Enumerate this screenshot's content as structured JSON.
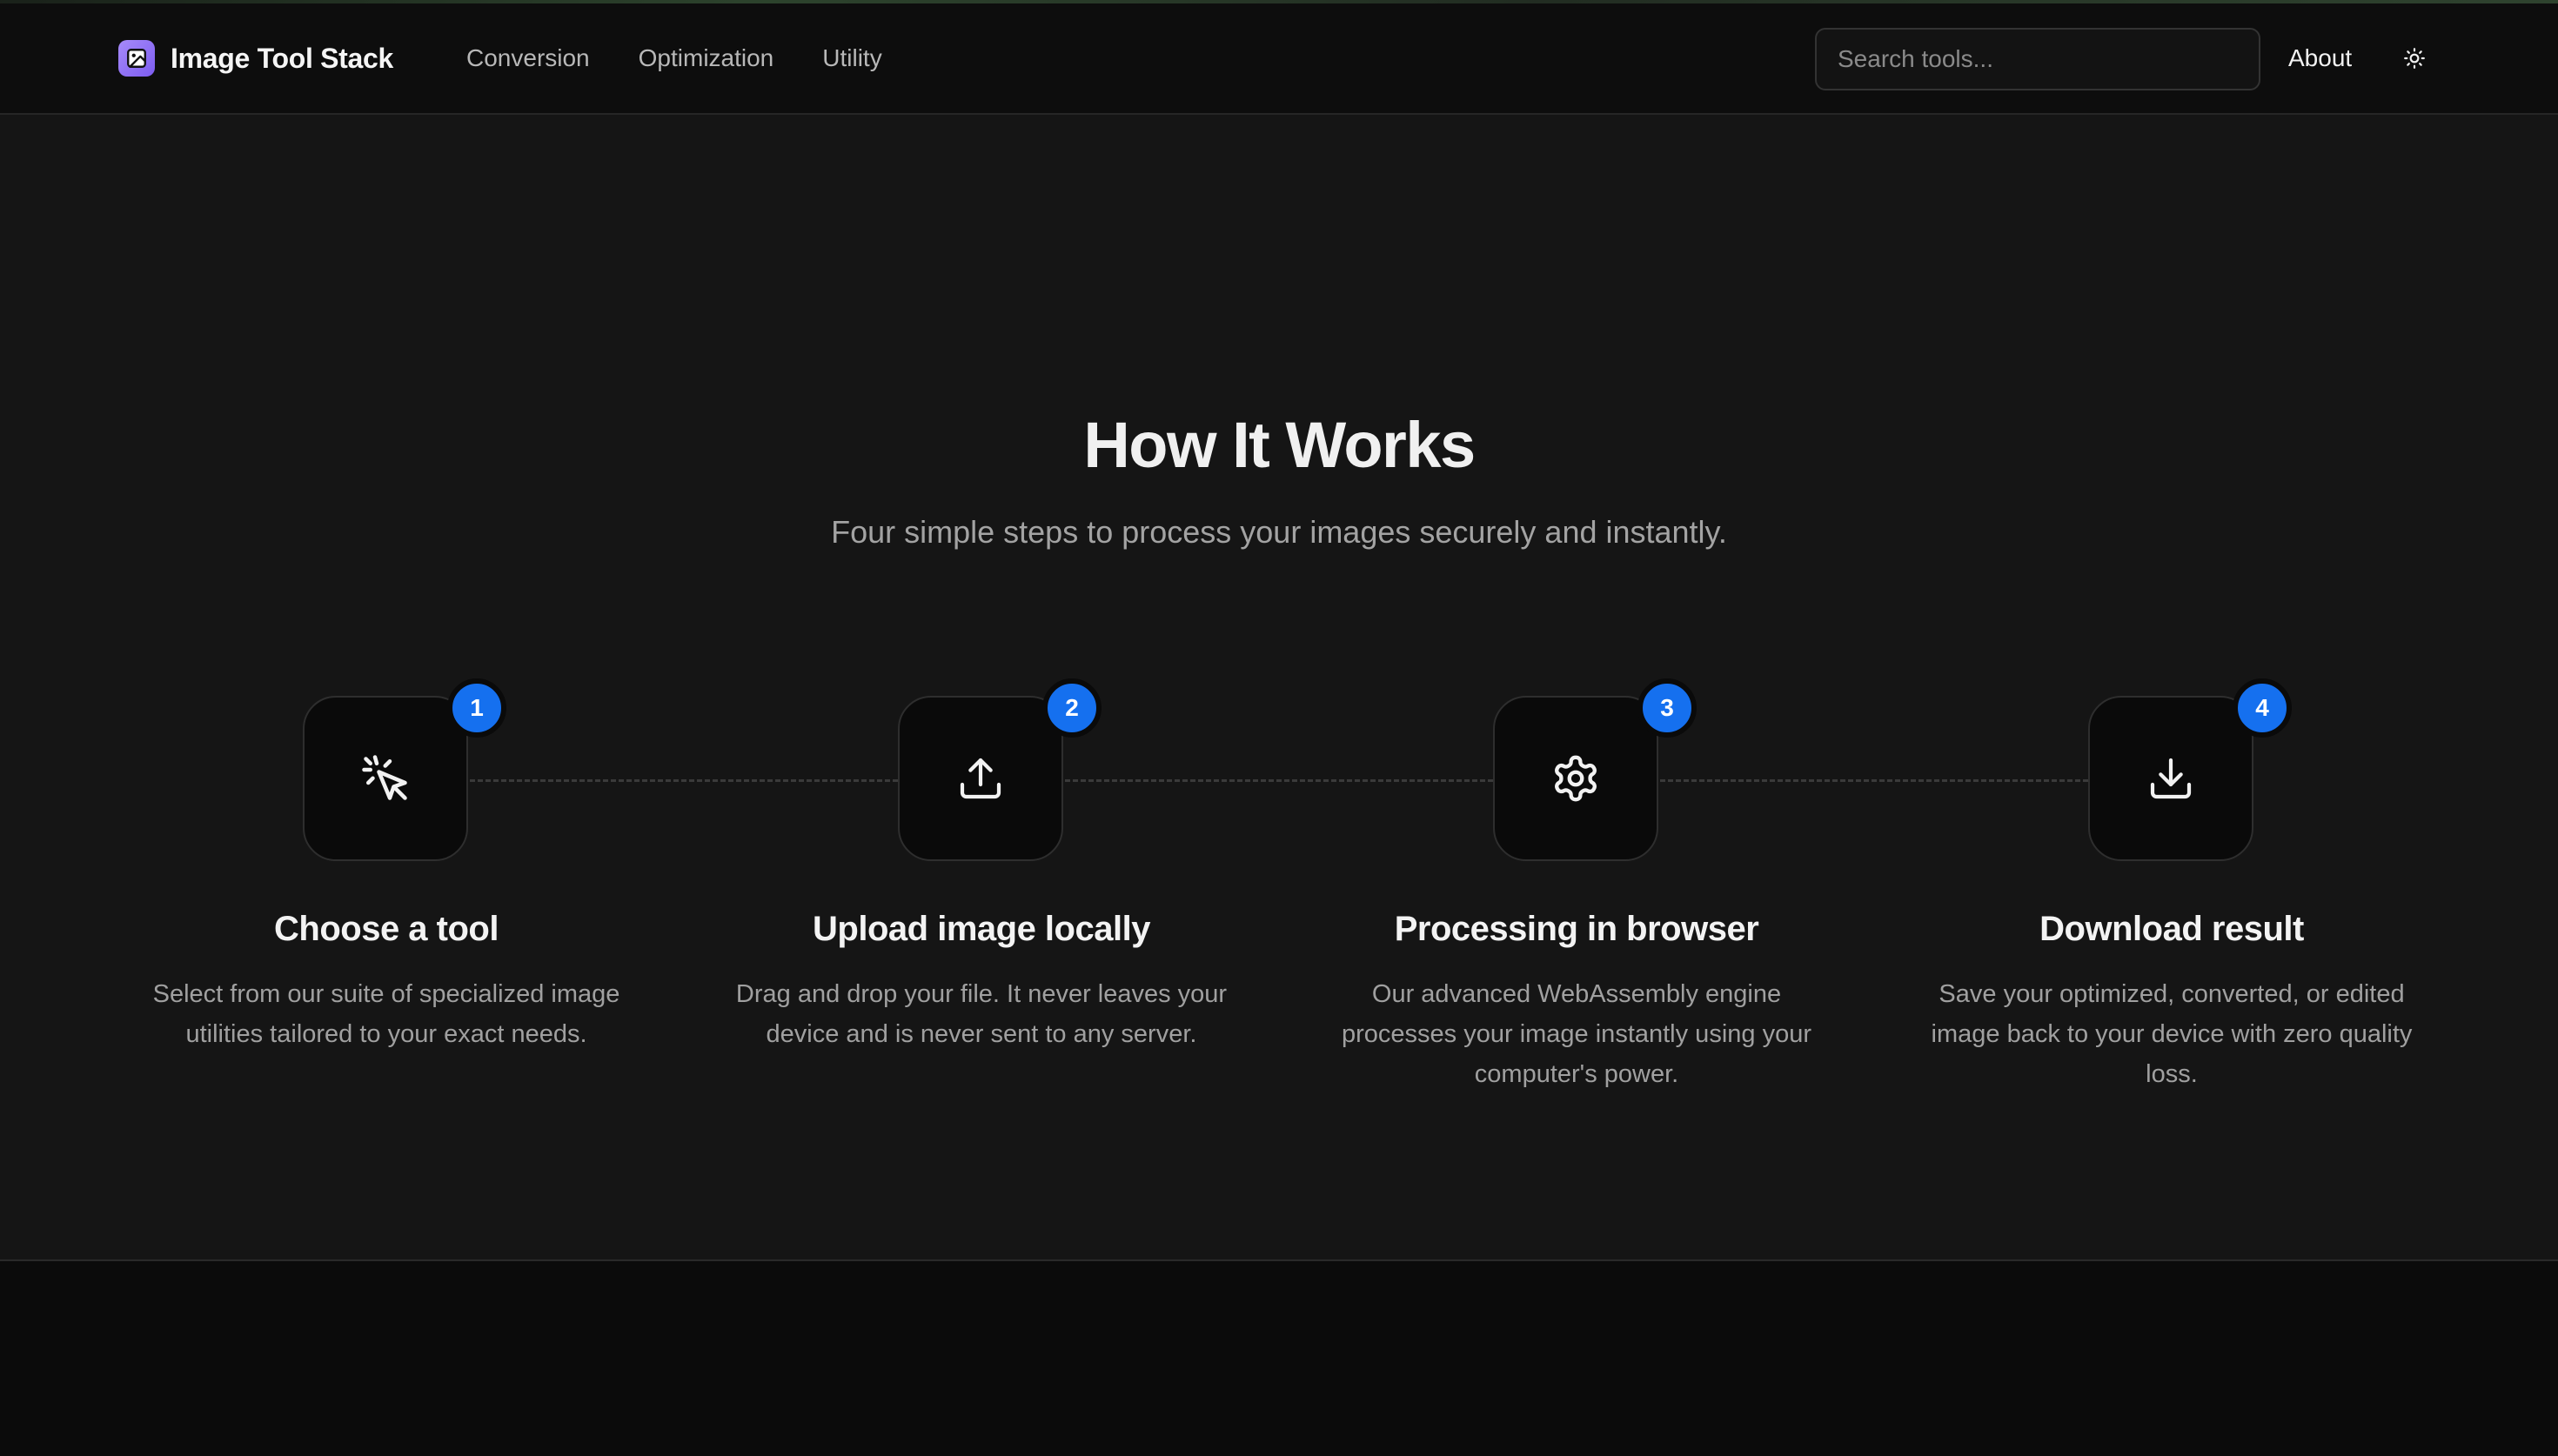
{
  "header": {
    "brand": "Image Tool Stack",
    "nav": [
      {
        "label": "Conversion"
      },
      {
        "label": "Optimization"
      },
      {
        "label": "Utility"
      }
    ],
    "search_placeholder": "Search tools...",
    "about_label": "About",
    "theme_toggle_icon": "sun-icon"
  },
  "section": {
    "title": "How It Works",
    "subtitle": "Four simple steps to process your images securely and instantly."
  },
  "steps": [
    {
      "number": "1",
      "icon": "pointer-click-icon",
      "title": "Choose a tool",
      "description": "Select from our suite of specialized image utilities tailored to your exact needs."
    },
    {
      "number": "2",
      "icon": "upload-icon",
      "title": "Upload image locally",
      "description": "Drag and drop your file. It never leaves your device and is never sent to any server."
    },
    {
      "number": "3",
      "icon": "gear-icon",
      "title": "Processing in browser",
      "description": "Our advanced WebAssembly engine processes your image instantly using your computer's power."
    },
    {
      "number": "4",
      "icon": "download-icon",
      "title": "Download result",
      "description": "Save your optimized, converted, or edited image back to your device with zero quality loss."
    }
  ],
  "colors": {
    "accent": "#1570ef",
    "brand_logo": "#8b6cf2",
    "background": "#151515",
    "header_background": "#0d0d0d"
  }
}
